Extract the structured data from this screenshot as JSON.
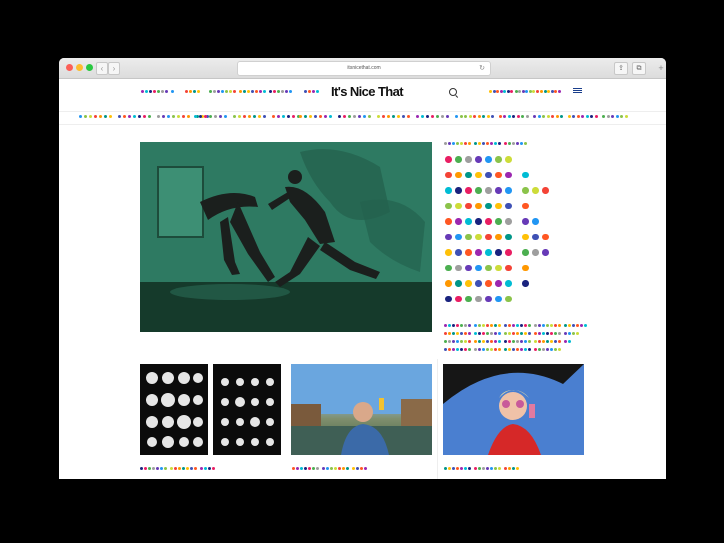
{
  "browser": {
    "url": "itsnicethat.com",
    "reload_icon": "↻",
    "back_icon": "‹",
    "forward_icon": "›",
    "share_icon": "⇪",
    "tabs_icon": "⧉",
    "new_tab_icon": "+"
  },
  "site": {
    "logo": "It's Nice That"
  },
  "colors": {
    "palette": [
      "#e91e63",
      "#9c27b0",
      "#ffc107",
      "#f44336",
      "#2196f3",
      "#4caf50",
      "#00bcd4",
      "#3f51b5",
      "#ff9800",
      "#8bc34a",
      "#9e9e9e",
      "#1a237e",
      "#ff5722",
      "#009688",
      "#cddc39",
      "#673ab7"
    ]
  }
}
